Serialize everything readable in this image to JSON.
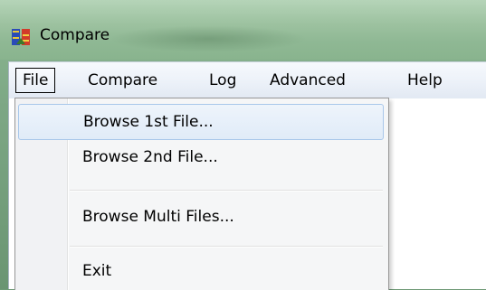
{
  "window": {
    "title": "Compare"
  },
  "menu_bar": {
    "items": [
      {
        "label": "File"
      },
      {
        "label": "Compare"
      },
      {
        "label": "Log"
      },
      {
        "label": "Advanced"
      },
      {
        "label": "Help"
      }
    ]
  },
  "file_menu": {
    "items": [
      {
        "label": "Browse 1st File..."
      },
      {
        "label": "Browse 2nd File..."
      },
      {
        "label": "Browse Multi Files..."
      },
      {
        "label": "Exit"
      }
    ]
  },
  "icons": {
    "app": "compare-app-icon"
  },
  "colors": {
    "highlight_border": "#a8c7ea",
    "menu_bg": "#f5f6f7"
  }
}
